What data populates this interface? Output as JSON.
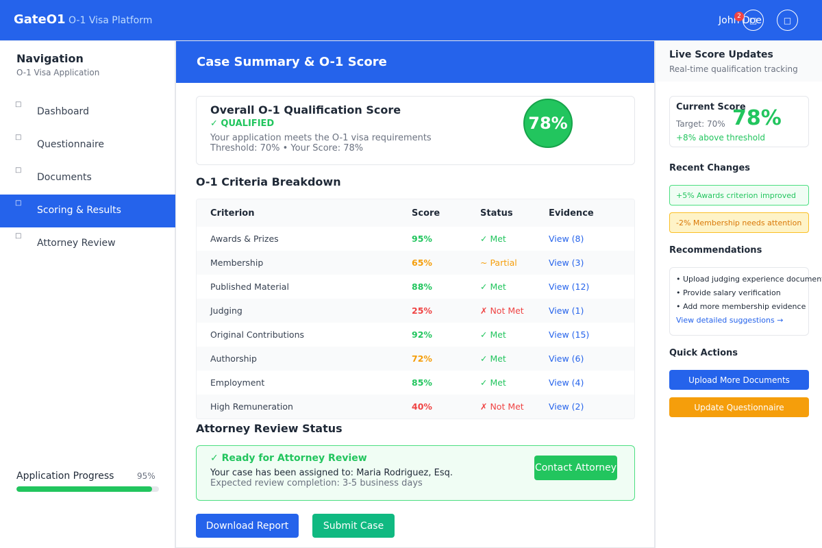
{
  "header": {
    "brand": "GateO1",
    "subtitle": "O-1 Visa Platform",
    "user_name": "John Doe",
    "notification_count": "2",
    "colors": {
      "primary": "#2563eb"
    }
  },
  "sidebar": {
    "title": "Navigation",
    "subtitle": "O-1 Visa Application",
    "items": [
      {
        "label": "Dashboard",
        "icon": "dashboard-icon",
        "active": false
      },
      {
        "label": "Questionnaire",
        "icon": "questionnaire-icon",
        "active": false
      },
      {
        "label": "Documents",
        "icon": "documents-icon",
        "active": false
      },
      {
        "label": "Scoring & Results",
        "icon": "scoring-icon",
        "active": true
      },
      {
        "label": "Attorney Review",
        "icon": "attorney-icon",
        "active": false
      }
    ],
    "progress": {
      "label": "Application Progress",
      "value_text": "95%",
      "value": 0.95
    }
  },
  "main": {
    "title": "Case Summary & O-1 Score",
    "score_card": {
      "title": "Overall O-1 Qualification Score",
      "status": "✓ QUALIFIED",
      "description": "Your application meets the O-1 visa requirements",
      "threshold_text": "Threshold: 70% • Your Score: 78%",
      "score": "78%"
    },
    "criteria": {
      "heading": "O-1 Criteria Breakdown",
      "columns": [
        "Criterion",
        "Score",
        "Status",
        "Evidence"
      ],
      "rows": [
        {
          "criterion": "Awards & Prizes",
          "score": "95%",
          "status": "✓ Met",
          "evidence": "View (8)",
          "level": "good"
        },
        {
          "criterion": "Membership",
          "score": "65%",
          "status": "~ Partial",
          "evidence": "View (3)",
          "level": "partial"
        },
        {
          "criterion": "Published Material",
          "score": "88%",
          "status": "✓ Met",
          "evidence": "View (12)",
          "level": "good"
        },
        {
          "criterion": "Judging",
          "score": "25%",
          "status": "✗ Not Met",
          "evidence": "View (1)",
          "level": "bad"
        },
        {
          "criterion": "Original Contributions",
          "score": "92%",
          "status": "✓ Met",
          "evidence": "View (15)",
          "level": "good"
        },
        {
          "criterion": "Authorship",
          "score": "72%",
          "status": "✓ Met",
          "evidence": "View (6)",
          "level": "good",
          "score_level": "partial"
        },
        {
          "criterion": "Employment",
          "score": "85%",
          "status": "✓ Met",
          "evidence": "View (4)",
          "level": "good"
        },
        {
          "criterion": "High Remuneration",
          "score": "40%",
          "status": "✗ Not Met",
          "evidence": "View (2)",
          "level": "bad"
        }
      ],
      "level_colors": {
        "good": "#22c55e",
        "partial": "#f59e0b",
        "bad": "#ef4444"
      }
    },
    "attorney": {
      "heading": "Attorney Review Status",
      "title": "✓ Ready for Attorney Review",
      "assigned": "Your case has been assigned to: Maria Rodriguez, Esq.",
      "expected": "Expected review completion: 3-5 business days",
      "contact_label": "Contact Attorney"
    },
    "buttons": {
      "download": "Download Report",
      "submit": "Submit Case"
    }
  },
  "right_panel": {
    "title": "Live Score Updates",
    "subtitle": "Real-time qualification tracking",
    "current": {
      "label": "Current Score",
      "target": "Target: 70%",
      "score": "78%",
      "delta": "+8% above threshold"
    },
    "changes_heading": "Recent Changes",
    "changes": [
      "+5% Awards criterion improved",
      "-2% Membership needs attention"
    ],
    "recommendations_heading": "Recommendations",
    "recommendations": [
      "• Upload judging experience documentation",
      "• Provide salary verification",
      "• Add more membership evidence"
    ],
    "recommendations_link": "View detailed suggestions →",
    "quick_actions_heading": "Quick Actions",
    "quick_actions": [
      "Upload More Documents",
      "Update Questionnaire"
    ]
  }
}
